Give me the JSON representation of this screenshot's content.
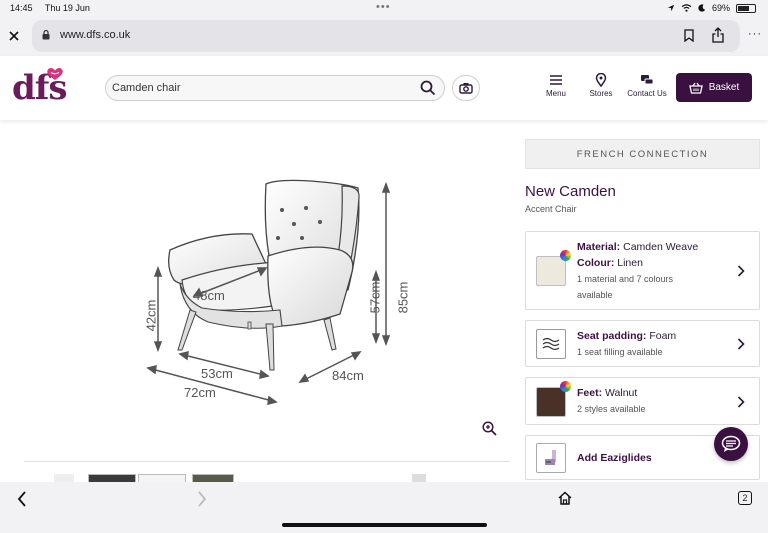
{
  "status_bar": {
    "time": "14:45",
    "date": "Thu 19 Jun",
    "battery": "69%",
    "battery_level": 0.69
  },
  "browser": {
    "url": "www.dfs.co.uk"
  },
  "header": {
    "logo_text": "dfs",
    "search": {
      "value": "Camden chair"
    },
    "nav": {
      "menu_label": "Menu",
      "stores_label": "Stores",
      "contact_label": "Contact Us"
    },
    "basket_label": "Basket"
  },
  "image": {
    "dimensions": {
      "seat_depth": "48cm",
      "seat_height": "42cm",
      "arm_height": "57cm",
      "total_height": "85cm",
      "width_inner": "53cm",
      "width_total": "72cm",
      "depth": "84cm"
    }
  },
  "product": {
    "brand": "FRENCH CONNECTION",
    "name": "New Camden",
    "subtitle": "Accent Chair",
    "options": [
      {
        "label": "Material:",
        "value": "Camden Weave",
        "label2": "Colour:",
        "value2": "Linen",
        "sub": "1 material and 7 colours available",
        "sub_line1": "1 material and 7 colours",
        "sub_line2": "available",
        "swatch_color": "#ede9dd"
      },
      {
        "label": "Seat padding:",
        "value": "Foam",
        "sub": "1 seat filling available"
      },
      {
        "label": "Feet:",
        "value": "Walnut",
        "sub": "2 styles available",
        "swatch_color": "#4a3128"
      },
      {
        "label": "Add Eaziglides"
      }
    ]
  },
  "colors": {
    "brand_purple": "#3a1040",
    "text_purple": "#3d1145",
    "logo_purple": "#6b1a5c"
  }
}
